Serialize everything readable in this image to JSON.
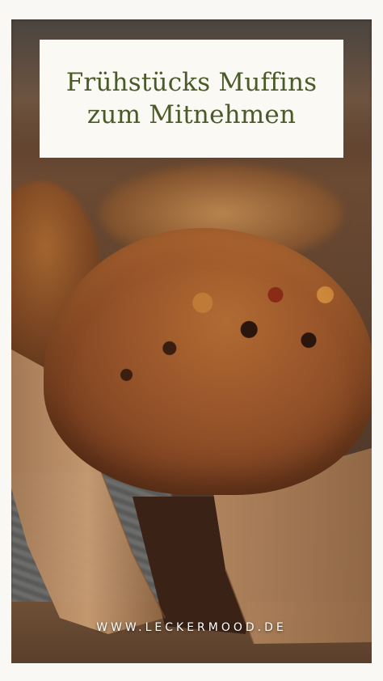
{
  "title": {
    "line1": "Frühstücks Muffins",
    "line2": "zum Mitnehmen"
  },
  "website": "WWW.LECKERMOOD.DE",
  "colors": {
    "title_text": "#4a5a28",
    "title_box": "#fbf9f4",
    "page_background": "#faf8f4"
  },
  "image": {
    "subject": "muffin-in-paper-liner"
  }
}
